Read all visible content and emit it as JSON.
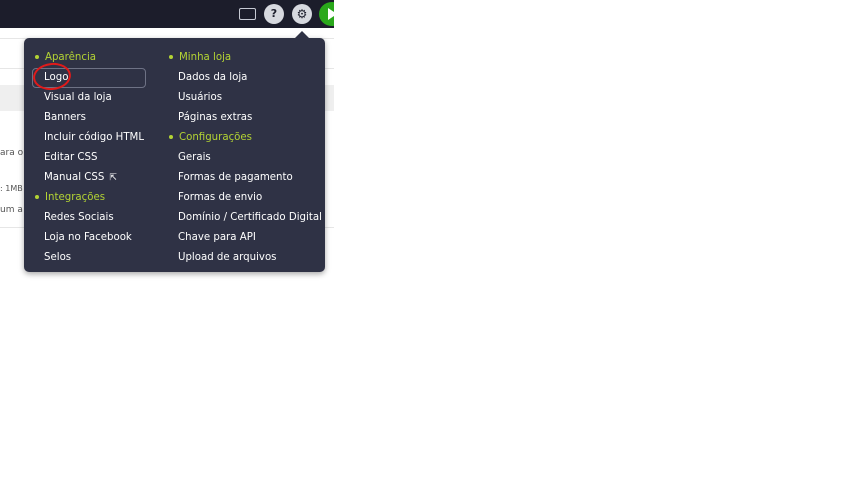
{
  "topbar": {
    "icons": [
      "monitor-icon",
      "help-icon",
      "gear-icon",
      "play-icon"
    ],
    "help_glyph": "?",
    "gear_glyph": "⚙"
  },
  "background_fragments": {
    "frag1": "ara o",
    "frag2": ": 1MB",
    "frag3": "um a"
  },
  "menu": {
    "column1": [
      {
        "type": "heading",
        "label": "Aparência"
      },
      {
        "type": "item",
        "label": "Logo",
        "selected": true
      },
      {
        "type": "item",
        "label": "Visual da loja"
      },
      {
        "type": "item",
        "label": "Banners"
      },
      {
        "type": "item",
        "label": "Incluir código HTML"
      },
      {
        "type": "item",
        "label": "Editar CSS"
      },
      {
        "type": "item",
        "label": "Manual CSS",
        "icon": "external-link-icon"
      },
      {
        "type": "heading",
        "label": "Integrações"
      },
      {
        "type": "item",
        "label": "Redes Sociais"
      },
      {
        "type": "item",
        "label": "Loja no Facebook"
      },
      {
        "type": "item",
        "label": "Selos"
      }
    ],
    "column2": [
      {
        "type": "heading",
        "label": "Minha loja"
      },
      {
        "type": "item",
        "label": "Dados da loja"
      },
      {
        "type": "item",
        "label": "Usuários"
      },
      {
        "type": "item",
        "label": "Páginas extras"
      },
      {
        "type": "heading",
        "label": "Configurações"
      },
      {
        "type": "item",
        "label": "Gerais"
      },
      {
        "type": "item",
        "label": "Formas de pagamento"
      },
      {
        "type": "item",
        "label": "Formas de envio"
      },
      {
        "type": "item",
        "label": "Domínio / Certificado Digital"
      },
      {
        "type": "item",
        "label": "Chave para API"
      },
      {
        "type": "item",
        "label": "Upload de arquivos"
      }
    ]
  },
  "colors": {
    "topbar": "#1c1d2b",
    "menu_bg": "#2f3245",
    "heading_accent": "#b3d334",
    "annotation": "#e01a1a"
  }
}
